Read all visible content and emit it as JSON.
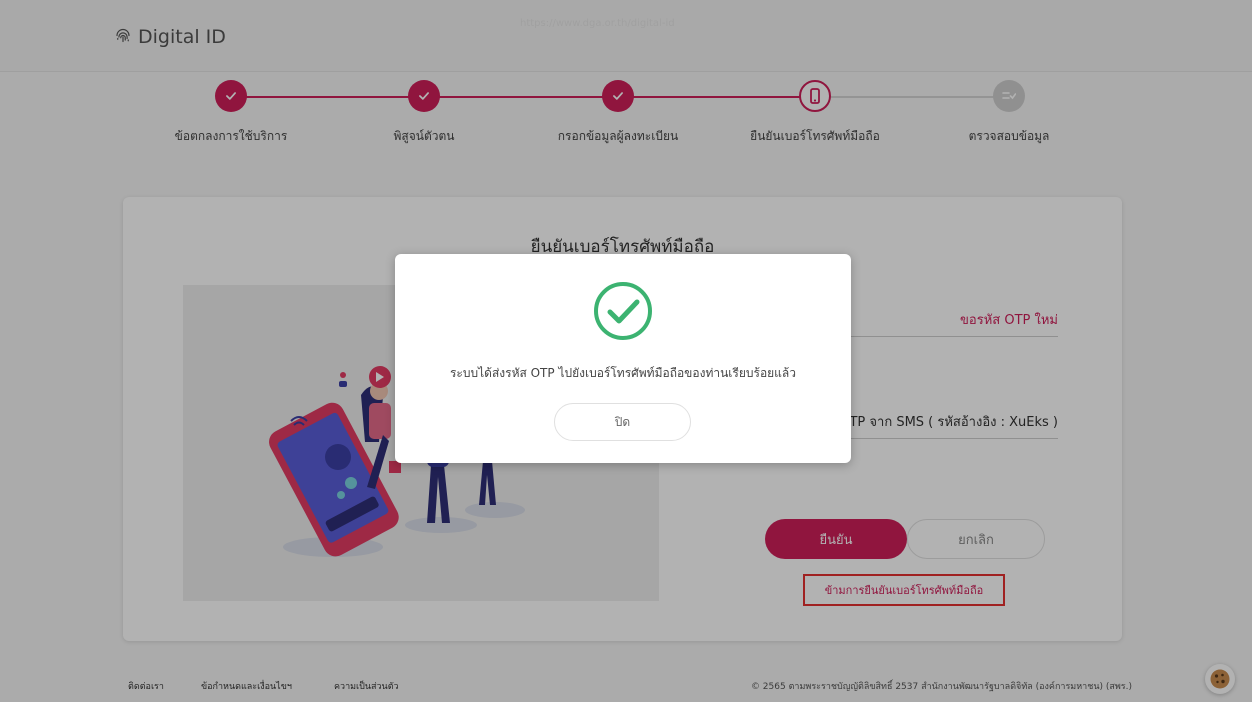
{
  "header": {
    "app_name": "Digital ID",
    "faint_url": "https://www.dga.or.th/digital-id"
  },
  "stepper": {
    "steps": [
      {
        "label": "ข้อตกลงการใช้บริการ",
        "state": "done"
      },
      {
        "label": "พิสูจน์ตัวตน",
        "state": "done"
      },
      {
        "label": "กรอกข้อมูลผู้ลงทะเบียน",
        "state": "done"
      },
      {
        "label": "ยืนยันเบอร์โทรศัพท์มือถือ",
        "state": "current"
      },
      {
        "label": "ตรวจสอบข้อมูล",
        "state": "todo"
      }
    ]
  },
  "card": {
    "title": "ยืนยันเบอร์โทรศัพท์มือถือ",
    "request_otp_link": "ขอรหัส OTP ใหม่",
    "otp_field_hint": "รหัส OTP จาก SMS ( รหัสอ้างอิง : XuEks )",
    "confirm_label": "ยืนยัน",
    "cancel_label": "ยกเลิก",
    "skip_label": "ข้ามการยืนยันเบอร์โทรศัพท์มือถือ"
  },
  "modal": {
    "message": "ระบบได้ส่งรหัส OTP ไปยังเบอร์โทรศัพท์มือถือของท่านเรียบร้อยแล้ว",
    "close_label": "ปิด"
  },
  "footer": {
    "contact": "ติดต่อเรา",
    "terms": "ข้อกำหนดและเงื่อนไขฯ",
    "privacy": "ความเป็นส่วนตัว",
    "copyright": "© 2565 ตามพระราชบัญญัติลิขสิทธิ์ 2537 สำนักงานพัฒนารัฐบาลดิจิทัล (องค์การมหาชน) (สพร.)"
  },
  "colors": {
    "accent": "#cf1f5a",
    "inactive": "#cfcfcf",
    "highlight_border": "#e53030",
    "success": "#3cb371"
  },
  "icons": [
    "fingerprint-icon",
    "check-icon",
    "phone-icon",
    "checklist-icon",
    "success-check-icon",
    "cookie-icon"
  ]
}
